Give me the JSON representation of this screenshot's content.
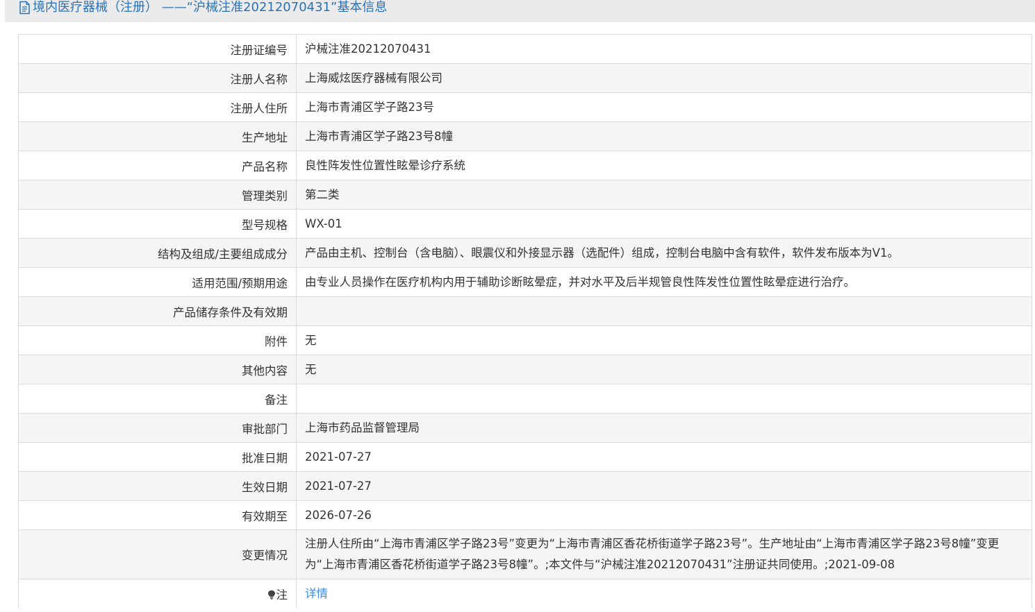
{
  "header": {
    "title": "境内医疗器械（注册） ——“沪械注准20212070431”基本信息",
    "icon": "document-icon"
  },
  "rows": [
    {
      "label": "注册证编号",
      "value": "沪械注准20212070431"
    },
    {
      "label": "注册人名称",
      "value": "上海威炫医疗器械有限公司"
    },
    {
      "label": "注册人住所",
      "value": "上海市青浦区学子路23号"
    },
    {
      "label": "生产地址",
      "value": "上海市青浦区学子路23号8幢"
    },
    {
      "label": "产品名称",
      "value": "良性阵发性位置性眩晕诊疗系统"
    },
    {
      "label": "管理类别",
      "value": "第二类"
    },
    {
      "label": "型号规格",
      "value": "WX-01"
    },
    {
      "label": "结构及组成/主要组成成分",
      "value": "产品由主机、控制台（含电脑）、眼震仪和外接显示器（选配件）组成，控制台电脑中含有软件，软件发布版本为V1。"
    },
    {
      "label": "适用范围/预期用途",
      "value": "由专业人员操作在医疗机构内用于辅助诊断眩晕症，并对水平及后半规管良性阵发性位置性眩晕症进行治疗。"
    },
    {
      "label": "产品储存条件及有效期",
      "value": ""
    },
    {
      "label": "附件",
      "value": "无"
    },
    {
      "label": "其他内容",
      "value": "无"
    },
    {
      "label": "备注",
      "value": ""
    },
    {
      "label": "审批部门",
      "value": "上海市药品监督管理局"
    },
    {
      "label": "批准日期",
      "value": "2021-07-27"
    },
    {
      "label": "生效日期",
      "value": "2021-07-27"
    },
    {
      "label": "有效期至",
      "value": "2026-07-26"
    },
    {
      "label": "变更情况",
      "value": "注册人住所由“上海市青浦区学子路23号”变更为“上海市青浦区香花桥街道学子路23号”。生产地址由“上海市青浦区学子路23号8幢”变更为“上海市青浦区香花桥街道学子路23号8幢”。;本文件与“沪械注准20212070431”注册证共同使用。;2021-09-08"
    }
  ],
  "note_row": {
    "label": "注",
    "icon": "lightbulb-icon",
    "link_label": "详情"
  },
  "colors": {
    "title": "#2b71b5",
    "link": "#3a8ee6",
    "border": "#dcdcdc",
    "stripe": "#f5f5f5",
    "header_bg": "#ebebeb"
  }
}
